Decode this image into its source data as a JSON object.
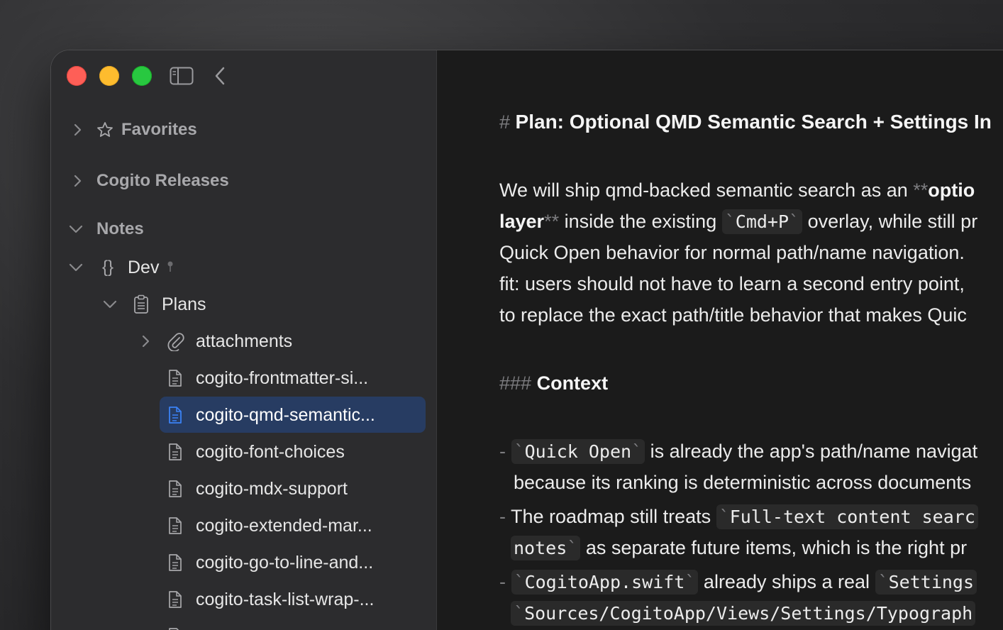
{
  "window": {
    "toolbar": {
      "sidebar_toggle_icon": "sidebar-toggle-icon",
      "back_icon": "chevron-left-icon"
    }
  },
  "sidebar": {
    "favorites": {
      "label": "Favorites",
      "icon": "star-icon"
    },
    "releases": {
      "label": "Cogito Releases"
    },
    "notes": {
      "label": "Notes"
    },
    "dev": {
      "label": "Dev",
      "icon": "braces-icon",
      "badge_icon": "pin-icon"
    },
    "plans": {
      "label": "Plans",
      "icon": "clipboard-icon"
    },
    "attachments": {
      "label": "attachments",
      "icon": "paperclip-icon"
    },
    "files": [
      {
        "label": "cogito-frontmatter-si...",
        "selected": false
      },
      {
        "label": "cogito-qmd-semantic...",
        "selected": true
      },
      {
        "label": "cogito-font-choices",
        "selected": false
      },
      {
        "label": "cogito-mdx-support",
        "selected": false
      },
      {
        "label": "cogito-extended-mar...",
        "selected": false
      },
      {
        "label": "cogito-go-to-line-and...",
        "selected": false
      },
      {
        "label": "cogito-task-list-wrap-...",
        "selected": false
      }
    ],
    "selected_color": "#273c62",
    "selected_icon_color": "#3b82f6"
  },
  "editor": {
    "h1_marker": "#",
    "title": "Plan: Optional QMD Semantic Search + Settings In",
    "p1": {
      "l1_text": "We will ship qmd-backed semantic search as an ",
      "l1_mark": "**",
      "l1_bold": "optio",
      "l2_bold": "layer",
      "l2_mark": "**",
      "l2_text1": " inside the existing ",
      "l2_code": "Cmd+P",
      "l2_text2": " overlay, while still pr",
      "l3": "Quick Open behavior for normal path/name navigation. ",
      "l4": "fit: users should not have to learn a second entry point,",
      "l5": "to replace the exact path/title behavior that makes Quic"
    },
    "h3_marker": "###",
    "context_heading": "Context",
    "bullets": {
      "marker": "-",
      "b1_code": "Quick Open",
      "b1_text": " is already the app's path/name navigat",
      "b1_cont": "because its ranking is deterministic across documents",
      "b2_text": "The roadmap still treats ",
      "b2_code": "Full-text content searc",
      "b2_code2": "notes",
      "b2_text2": " as separate future items, which is the right pr",
      "b3_code": "CogitoApp.swift",
      "b3_text": " already ships a real ",
      "b3_code2": "Settings ",
      "b3_code3": "Sources/CogitoApp/Views/Settings/Typograph"
    },
    "tick": "`"
  },
  "colors": {
    "window_bg": "#1b1b1b",
    "sidebar_bg": "#2c2c2e",
    "close": "#fe5f57",
    "minimize": "#febc2e",
    "maximize": "#28c840"
  }
}
